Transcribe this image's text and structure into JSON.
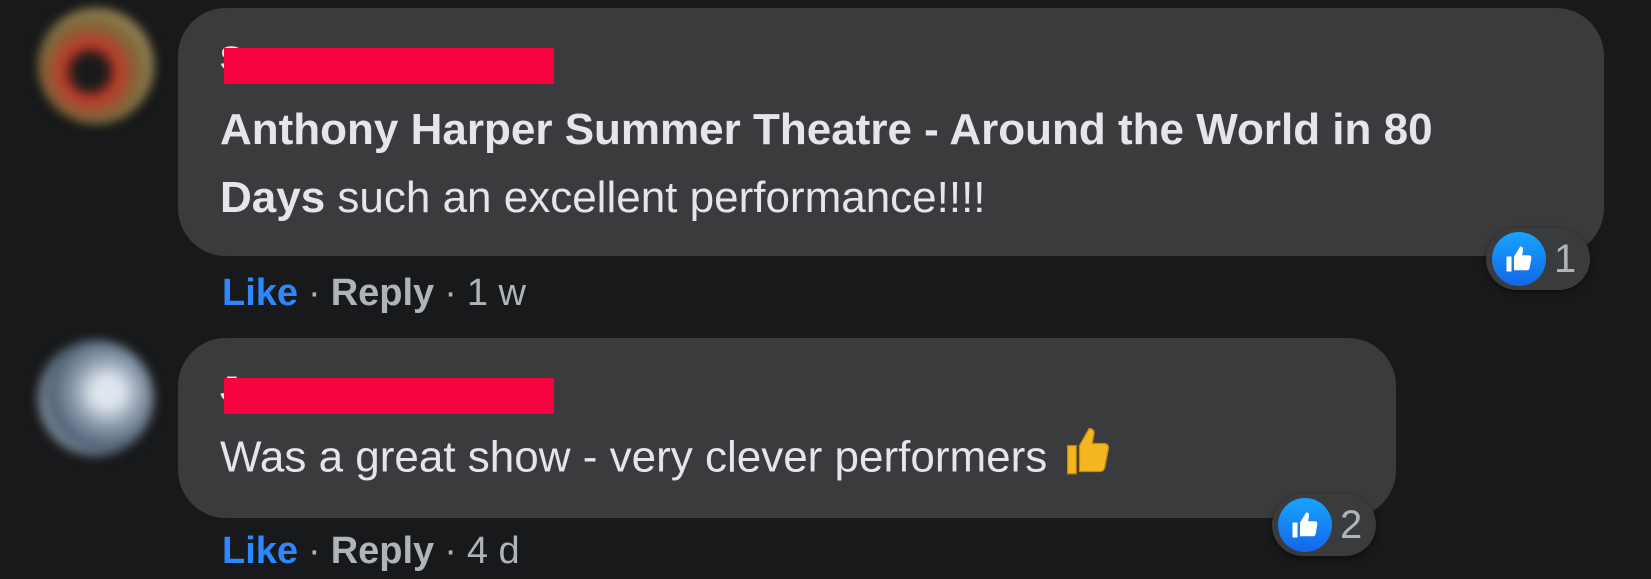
{
  "comments": [
    {
      "author": "S",
      "text_bold": "Anthony Harper Summer Theatre - Around the World in 80 Days",
      "text_rest": " such an excellent performance!!!!",
      "reaction_count": "1",
      "actions": {
        "like": "Like",
        "reply": "Reply",
        "separator": "·",
        "time": "1 w"
      }
    },
    {
      "author": "J",
      "text_bold": "",
      "text_rest": "Was a great show - very clever performers",
      "emoji": "thumbs-up-emoji",
      "reaction_count": "2",
      "actions": {
        "like": "Like",
        "reply": "Reply",
        "separator": "·",
        "time": "4 d"
      }
    }
  ],
  "colors": {
    "background": "#18191a",
    "bubble": "#3a3b3c",
    "text": "#e4e6eb",
    "muted": "#b0b3b8",
    "link": "#2d88ff",
    "redaction": "#f5043f"
  }
}
